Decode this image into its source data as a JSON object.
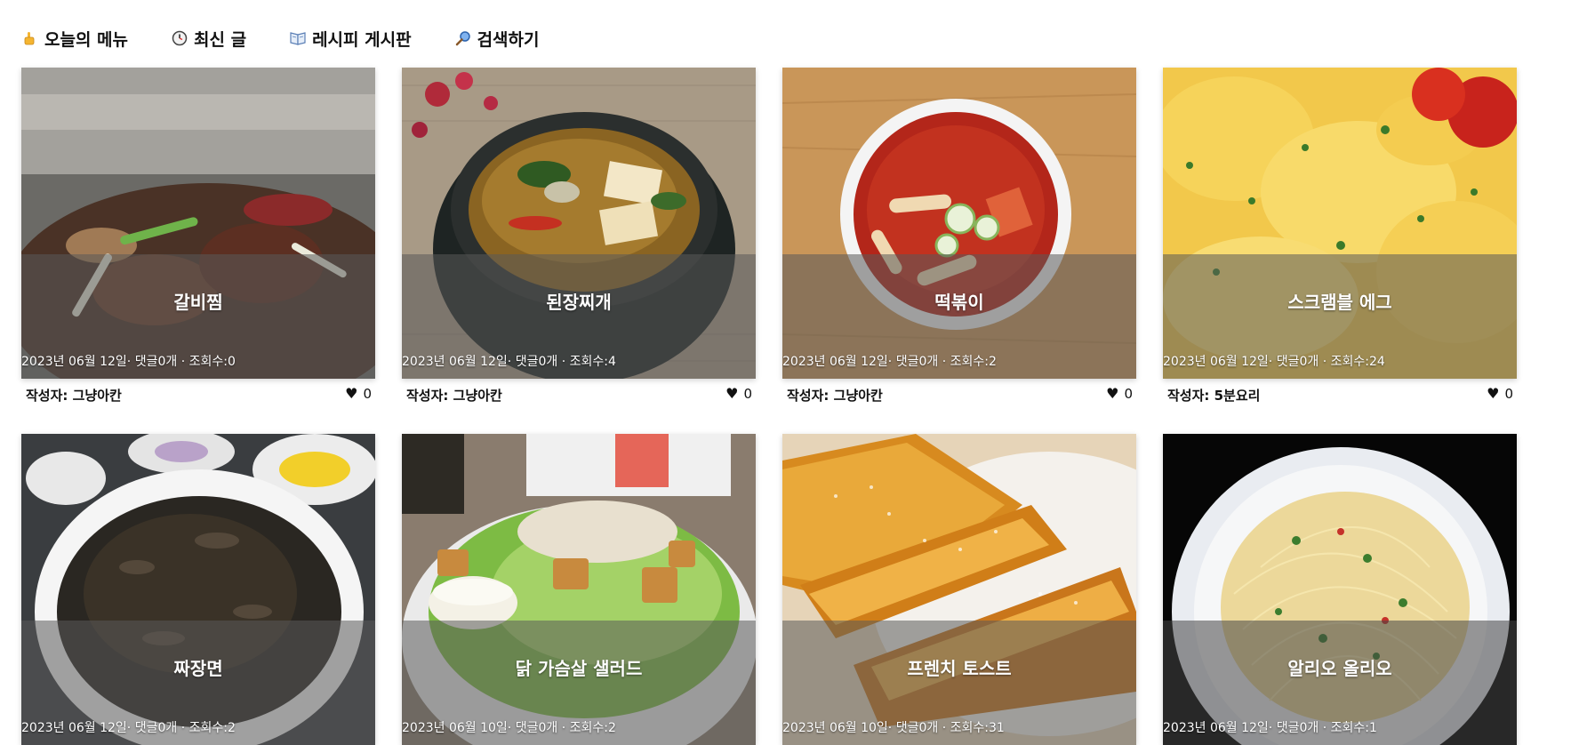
{
  "nav": {
    "items": [
      {
        "label": "오늘의 메뉴",
        "icon": "thumbs-up-icon"
      },
      {
        "label": "최신 글",
        "icon": "clock-icon"
      },
      {
        "label": "레시피 게시판",
        "icon": "book-icon"
      },
      {
        "label": "검색하기",
        "icon": "magnifier-icon"
      }
    ]
  },
  "author_prefix": "작성자: ",
  "cards": [
    {
      "title": "갈비찜",
      "meta": "2023년 06월 12일· 댓글0개 · 조회수:0",
      "author": "그냥아칸",
      "likes": "0",
      "theme": "galbi"
    },
    {
      "title": "된장찌개",
      "meta": "2023년 06월 12일· 댓글0개 · 조회수:4",
      "author": "그냥아칸",
      "likes": "0",
      "theme": "doenjang"
    },
    {
      "title": "떡볶이",
      "meta": "2023년 06월 12일· 댓글0개 · 조회수:2",
      "author": "그냥아칸",
      "likes": "0",
      "theme": "tteokbokki"
    },
    {
      "title": "스크램블 에그",
      "meta": "2023년 06월 12일· 댓글0개 · 조회수:24",
      "author": "5분요리",
      "likes": "0",
      "theme": "egg"
    },
    {
      "title": "짜장면",
      "meta": "2023년 06월 12일· 댓글0개 · 조회수:2",
      "author": "",
      "likes": "",
      "theme": "jjajang"
    },
    {
      "title": "닭 가슴살 샐러드",
      "meta": "2023년 06월 10일· 댓글0개 · 조회수:2",
      "author": "",
      "likes": "",
      "theme": "salad"
    },
    {
      "title": "프렌치 토스트",
      "meta": "2023년 06월 10일· 댓글0개 · 조회수:31",
      "author": "",
      "likes": "",
      "theme": "toast"
    },
    {
      "title": "알리오 올리오",
      "meta": "2023년 06월 12일· 댓글0개 · 조회수:1",
      "author": "",
      "likes": "",
      "theme": "pasta"
    }
  ],
  "colors": {
    "overlay": "#5a5a5a",
    "text": "#111111",
    "title_text": "#ffffff"
  }
}
